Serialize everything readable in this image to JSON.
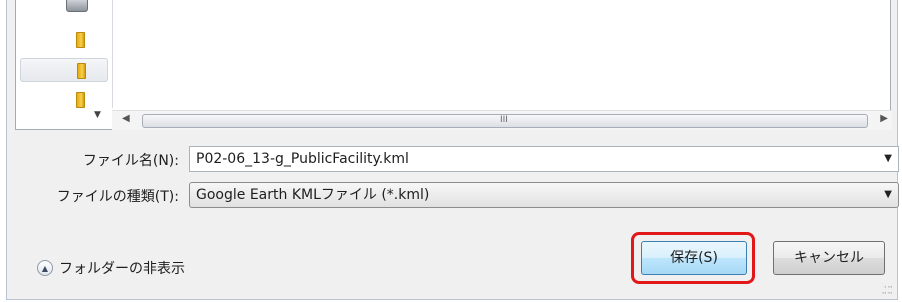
{
  "file_name": {
    "label": "ファイル名(N):",
    "value": "P02-06_13-g_PublicFacility.kml"
  },
  "file_type": {
    "label": "ファイルの種類(T):",
    "selected": "Google Earth KMLファイル (*.kml)"
  },
  "folder_toggle": {
    "label": "フォルダーの非表示"
  },
  "buttons": {
    "save": "保存(S)",
    "cancel": "キャンセル"
  },
  "scrollbar": {
    "grip": "III"
  },
  "icons": [
    "drive-icon",
    "folder-icon",
    "chevron-up-icon",
    "chevron-down-icon",
    "arrow-left-icon",
    "arrow-right-icon",
    "resize-grip-icon"
  ],
  "colors": {
    "highlight": "#e01818",
    "save_button_border": "#3c7fb1",
    "folder": "#f6d04d"
  }
}
